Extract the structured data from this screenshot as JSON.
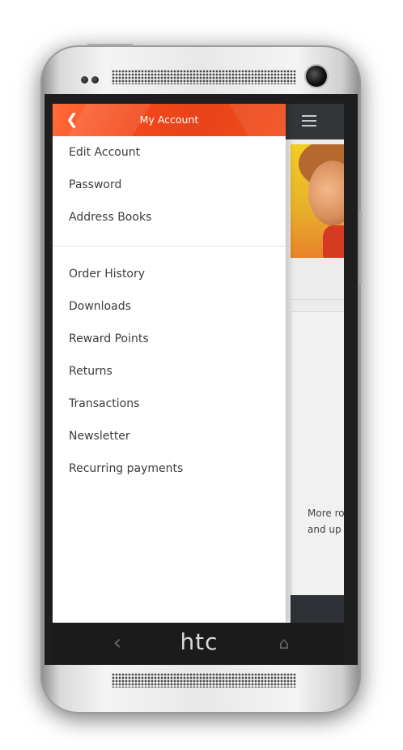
{
  "drawer": {
    "title": "My Account",
    "back_icon": "chevron-left-icon",
    "account_items": [
      {
        "label": "Edit Account"
      },
      {
        "label": "Password"
      },
      {
        "label": "Address Books"
      }
    ],
    "order_items": [
      {
        "label": "Order History"
      },
      {
        "label": "Downloads"
      },
      {
        "label": "Reward Points"
      },
      {
        "label": "Returns"
      },
      {
        "label": "Transactions"
      },
      {
        "label": "Newsletter"
      },
      {
        "label": "Recurring payments"
      }
    ]
  },
  "background_page": {
    "menu_icon": "hamburger-menu-icon",
    "card_text_line1": "More ro",
    "card_text_line2": "and up t"
  },
  "device": {
    "brand": "htc",
    "nav_back_icon": "back-arrow-icon",
    "nav_home_icon": "home-icon"
  },
  "colors": {
    "accent": "#f2491b",
    "header_dark": "#333638"
  }
}
